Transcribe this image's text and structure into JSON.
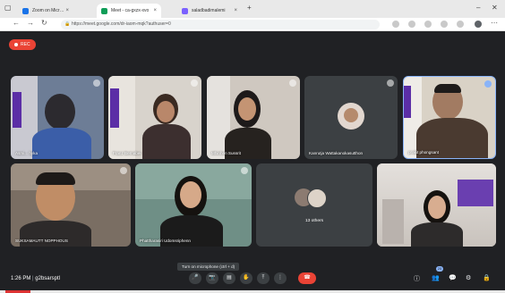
{
  "browser": {
    "tabs": [
      {
        "title": "Zoom on Microsoft Edx",
        "favicon": "#1a73e8"
      },
      {
        "title": "Meet - ca-gxzx-xvo",
        "favicon": "#0f9d58"
      },
      {
        "title": "saladbadimalemi",
        "favicon": "#7b61ff"
      }
    ],
    "new_tab": "+",
    "url": "https://meet.google.com/dr-iaom-mqk?authuser=0",
    "window_controls": [
      "–",
      "◻",
      "✕"
    ]
  },
  "meet": {
    "rec_label": "REC",
    "participants": [
      {
        "name": "Asmi... hyka"
      },
      {
        "name": "Franz Bernabei"
      },
      {
        "name": "Mhinhen Sussrit"
      },
      {
        "name": "Kanrutja Wattakanokasutthon"
      },
      {
        "name": "prakit phongsant"
      },
      {
        "name": "SUKSAMAUTT NOPPHOUS"
      },
      {
        "name": "Phattharasiri Udomsriphenn"
      },
      {
        "name": "13 others"
      },
      {
        "name": ""
      }
    ],
    "time": "1:26 PM",
    "meeting_code": "g2bsarsptl",
    "tooltip": "Turn on microphone (ctrl + d)",
    "people_count": "20",
    "controls": {
      "mic": "🎤",
      "camera": "📷",
      "captions": "▤",
      "raise_hand": "✋",
      "present": "⤒",
      "more": "⋮",
      "end": "☎"
    },
    "right_icons": [
      "ⓘ",
      "👥",
      "💬",
      "⚙",
      "🔒"
    ]
  },
  "colors": {
    "accent_red": "#ea4335",
    "meet_bg": "#202124",
    "tile_bg": "#3c4043",
    "accent_blue": "#8ab4f8"
  }
}
